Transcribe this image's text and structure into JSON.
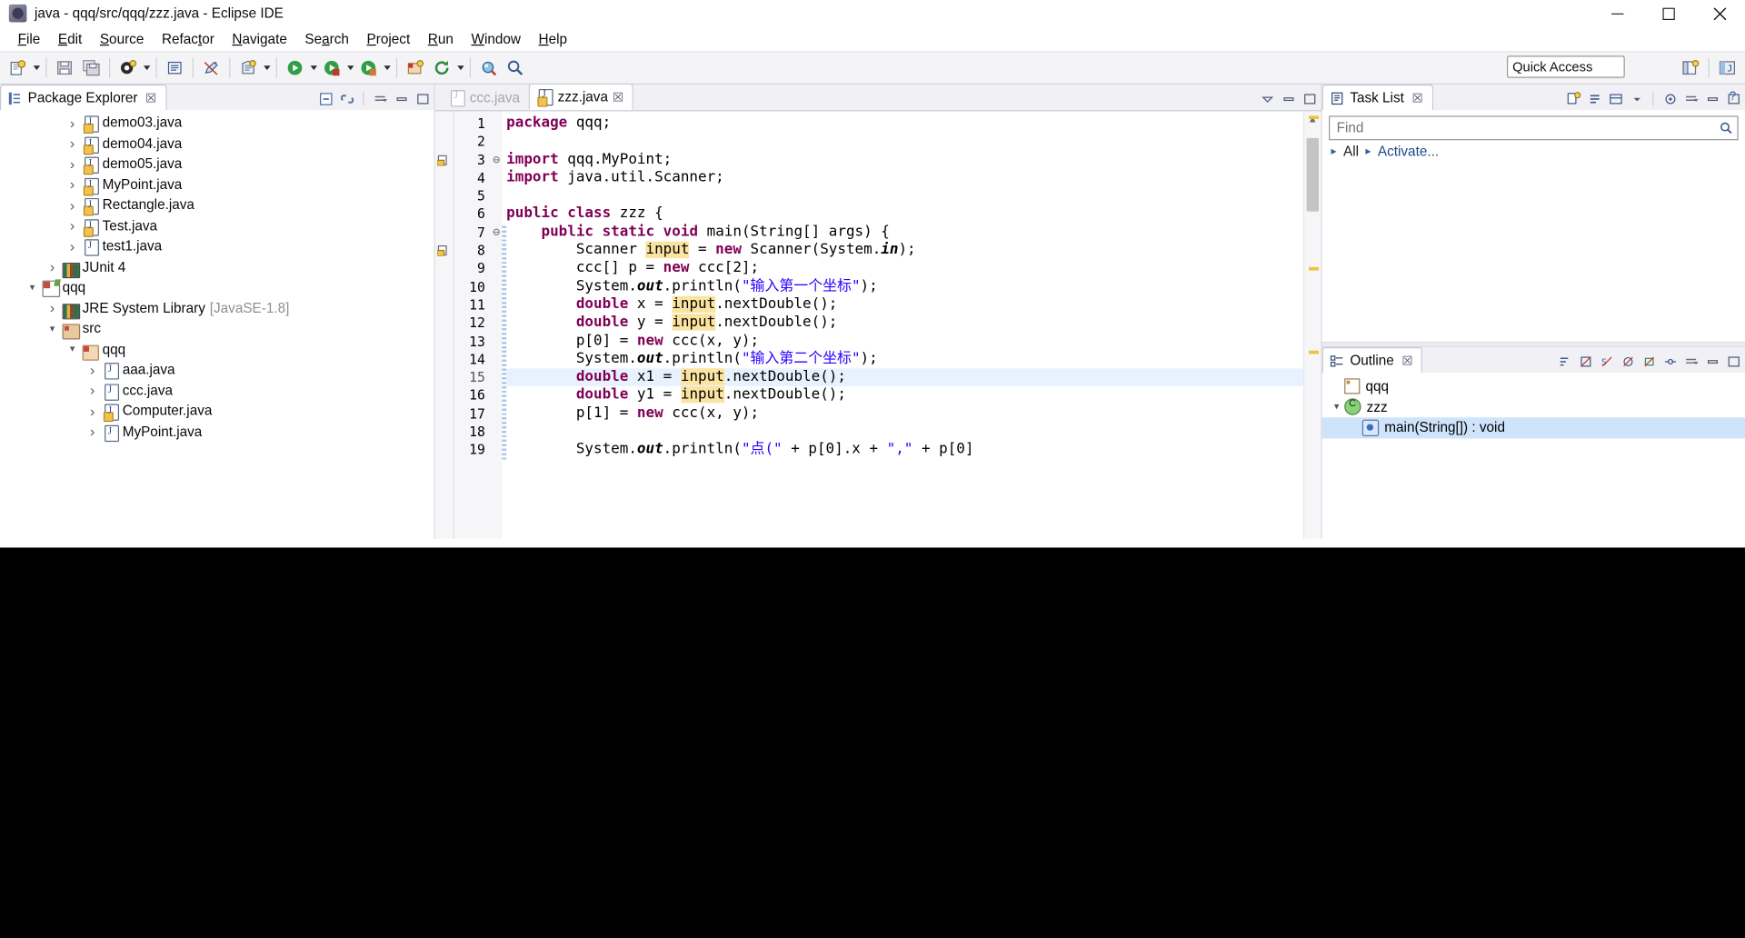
{
  "window": {
    "title": "java - qqq/src/qqq/zzz.java - Eclipse IDE",
    "app_icon": "eclipse-icon",
    "minimize": "─",
    "maximize": "□",
    "close": "✕"
  },
  "menubar": {
    "items": [
      {
        "label": "File",
        "mnemonic": "F"
      },
      {
        "label": "Edit",
        "mnemonic": "E"
      },
      {
        "label": "Source",
        "mnemonic": "S"
      },
      {
        "label": "Refactor",
        "mnemonic": "t"
      },
      {
        "label": "Navigate",
        "mnemonic": "N"
      },
      {
        "label": "Search",
        "mnemonic": "a"
      },
      {
        "label": "Project",
        "mnemonic": "P"
      },
      {
        "label": "Run",
        "mnemonic": "R"
      },
      {
        "label": "Window",
        "mnemonic": "W"
      },
      {
        "label": "Help",
        "mnemonic": "H"
      }
    ]
  },
  "toolbar": {
    "quick_access": "Quick Access",
    "buttons": [
      "new-wizard-icon",
      "save-icon",
      "save-all-icon",
      "print-icon",
      "new-java-class-icon",
      "toggle-mark-occurrences-icon",
      "new-java-project-icon",
      "external-tools-icon",
      "run-icon",
      "debug-icon",
      "coverage-icon",
      "new-package-icon",
      "refresh-icon",
      "search-icon",
      "open-type-icon",
      "open-task-icon",
      "previous-annotation-icon",
      "next-annotation-icon",
      "back-icon",
      "forward-icon"
    ],
    "perspective_java": "java-perspective-icon",
    "open-perspective": "open-perspective-icon"
  },
  "package_explorer": {
    "title": "Package Explorer",
    "close": "☒",
    "toolbar": [
      "collapse-all-icon",
      "link-with-editor-icon",
      "view-menu-icon",
      "minimize-icon",
      "maximize-icon"
    ],
    "tree": [
      {
        "label": "demo03.java",
        "indent": 3,
        "arrow": "right",
        "icon": "java-file-warning-icon"
      },
      {
        "label": "demo04.java",
        "indent": 3,
        "arrow": "right",
        "icon": "java-file-warning-icon"
      },
      {
        "label": "demo05.java",
        "indent": 3,
        "arrow": "right",
        "icon": "java-file-warning-icon"
      },
      {
        "label": "MyPoint.java",
        "indent": 3,
        "arrow": "right",
        "icon": "java-file-warning-icon"
      },
      {
        "label": "Rectangle.java",
        "indent": 3,
        "arrow": "right",
        "icon": "java-file-warning-icon"
      },
      {
        "label": "Test.java",
        "indent": 3,
        "arrow": "right",
        "icon": "java-file-warning-icon"
      },
      {
        "label": "test1.java",
        "indent": 3,
        "arrow": "right",
        "icon": "java-file-icon"
      },
      {
        "label": "JUnit 4",
        "indent": 2,
        "arrow": "right",
        "icon": "library-icon"
      },
      {
        "label": "qqq",
        "indent": 1,
        "arrow": "down",
        "icon": "java-project-icon"
      },
      {
        "label": "JRE System Library",
        "suffix": "[JavaSE-1.8]",
        "indent": 2,
        "arrow": "right",
        "icon": "library-icon"
      },
      {
        "label": "src",
        "indent": 2,
        "arrow": "down",
        "icon": "source-folder-icon"
      },
      {
        "label": "qqq",
        "indent": 3,
        "arrow": "down",
        "icon": "package-icon"
      },
      {
        "label": "aaa.java",
        "indent": 4,
        "arrow": "right",
        "icon": "java-file-icon"
      },
      {
        "label": "ccc.java",
        "indent": 4,
        "arrow": "right",
        "icon": "java-file-icon"
      },
      {
        "label": "Computer.java",
        "indent": 4,
        "arrow": "right",
        "icon": "java-file-warning-icon"
      },
      {
        "label": "MyPoint.java",
        "indent": 4,
        "arrow": "right",
        "icon": "java-file-icon"
      }
    ]
  },
  "editor": {
    "tabs": [
      {
        "label": "ccc.java",
        "active": false,
        "icon": "java-file-icon",
        "close": "☒"
      },
      {
        "label": "zzz.java",
        "active": true,
        "icon": "java-file-warning-icon",
        "close": "☒"
      }
    ],
    "highlighted_line": 15,
    "lines": [
      {
        "n": 1,
        "fold": "",
        "text": "package qqq;"
      },
      {
        "n": 2,
        "fold": "",
        "text": ""
      },
      {
        "n": 3,
        "fold": "⊖",
        "text": "import qqq.MyPoint;",
        "annotation": "warning"
      },
      {
        "n": 4,
        "fold": "",
        "text": "import java.util.Scanner;"
      },
      {
        "n": 5,
        "fold": "",
        "text": ""
      },
      {
        "n": 6,
        "fold": "",
        "text": "public class zzz {"
      },
      {
        "n": 7,
        "fold": "⊖",
        "text": "    public static void main(String[] args) {"
      },
      {
        "n": 8,
        "fold": "",
        "text": "        Scanner input = new Scanner(System.in);",
        "annotation": "warning"
      },
      {
        "n": 9,
        "fold": "",
        "text": "        ccc[] p = new ccc[2];"
      },
      {
        "n": 10,
        "fold": "",
        "text": "        System.out.println(\"输入第一个坐标\");"
      },
      {
        "n": 11,
        "fold": "",
        "text": "        double x = input.nextDouble();"
      },
      {
        "n": 12,
        "fold": "",
        "text": "        double y = input.nextDouble();"
      },
      {
        "n": 13,
        "fold": "",
        "text": "        p[0] = new ccc(x, y);"
      },
      {
        "n": 14,
        "fold": "",
        "text": "        System.out.println(\"输入第二个坐标\");"
      },
      {
        "n": 15,
        "fold": "",
        "text": "        double x1 = input.nextDouble();"
      },
      {
        "n": 16,
        "fold": "",
        "text": "        double y1 = input.nextDouble();"
      },
      {
        "n": 17,
        "fold": "",
        "text": "        p[1] = new ccc(x, y);"
      },
      {
        "n": 18,
        "fold": "",
        "text": ""
      },
      {
        "n": 19,
        "fold": "",
        "text": "        System.out.println(\"点(\" + p[0].x + \",\" + p[0]"
      }
    ]
  },
  "task_list": {
    "title": "Task List",
    "close": "☒",
    "search_placeholder": "Find",
    "search_value": "",
    "filter_all": "All",
    "filter_activate": "Activate...",
    "toolbar": [
      "new-task-icon",
      "categorize-icon",
      "presentation-icon",
      "focus-icon",
      "view-menu-icon",
      "minimize-icon",
      "maximize-icon"
    ],
    "help": "?"
  },
  "outline": {
    "title": "Outline",
    "close": "☒",
    "toolbar": [
      "sort-icon",
      "hide-fields-icon",
      "hide-static-icon",
      "hide-nonpublic-icon",
      "hide-local-icon",
      "focus-icon",
      "view-menu-icon",
      "minimize-icon",
      "maximize-icon"
    ],
    "items": [
      {
        "label": "qqq",
        "indent": 0,
        "arrow": "",
        "icon": "package-declaration-icon",
        "selected": false
      },
      {
        "label": "zzz",
        "indent": 0,
        "arrow": "down",
        "icon": "class-icon",
        "selected": false
      },
      {
        "label": "main(String[]) : void",
        "indent": 1,
        "arrow": "",
        "icon": "public-static-method-icon",
        "selected": true
      }
    ]
  },
  "colors": {
    "keyword": "#7f0055",
    "string": "#2a00ff",
    "field": "#0000c0",
    "occurrence_highlight": "#fbe3a0",
    "current_line": "#e8f2fe",
    "selection": "#cfe4fb",
    "chrome": "#f0f0f5",
    "accent": "#3a6fbf"
  }
}
